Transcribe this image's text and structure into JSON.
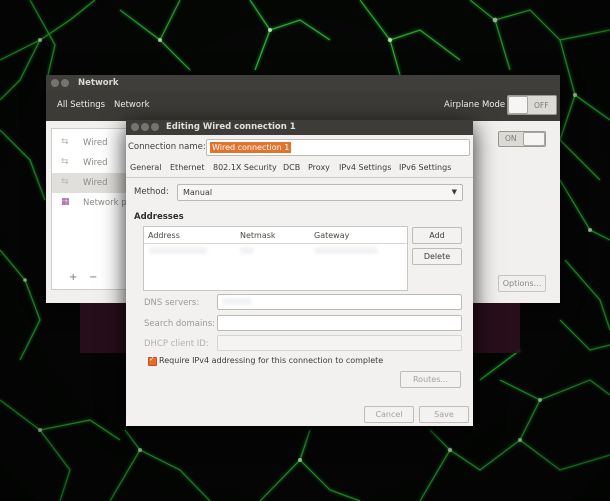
{
  "network_window": {
    "title": "Network",
    "toolbar": {
      "all_settings": "All Settings",
      "network": "Network"
    },
    "airplane_mode": {
      "label": "Airplane Mode",
      "state": "OFF"
    },
    "sidebar_items": [
      {
        "icon": "ethernet-icon",
        "label": "Wired"
      },
      {
        "icon": "ethernet-icon",
        "label": "Wired"
      },
      {
        "icon": "ethernet-icon",
        "label": "Wired"
      },
      {
        "icon": "network-proxy-icon",
        "label": "Network p"
      }
    ],
    "wired_toggle": "ON",
    "add_label": "+",
    "remove_label": "−",
    "options_label": "Options..."
  },
  "dialog": {
    "title": "Editing Wired connection 1",
    "connection_name_label": "Connection name:",
    "connection_name_value": "Wired connection 1",
    "tabs": [
      "General",
      "Ethernet",
      "802.1X Security",
      "DCB",
      "Proxy",
      "IPv4 Settings",
      "IPv6 Settings"
    ],
    "active_tab": "IPv4 Settings",
    "method_label": "Method:",
    "method_value": "Manual",
    "addresses_label": "Addresses",
    "columns": [
      "Address",
      "Netmask",
      "Gateway"
    ],
    "add_button": "Add",
    "delete_button": "Delete",
    "dns_label": "DNS servers:",
    "search_domains_label": "Search domains:",
    "dhcp_client_id_label": "DHCP client ID:",
    "require_ipv4_label": "Require IPv4 addressing for this connection to complete",
    "routes_button": "Routes...",
    "cancel_button": "Cancel",
    "save_button": "Save"
  },
  "colors": {
    "selection_orange": "#e2732d",
    "titlebar": "#3d3c38",
    "window_bg": "#f2f1f0",
    "wallpaper_green": "#2fd03b"
  }
}
